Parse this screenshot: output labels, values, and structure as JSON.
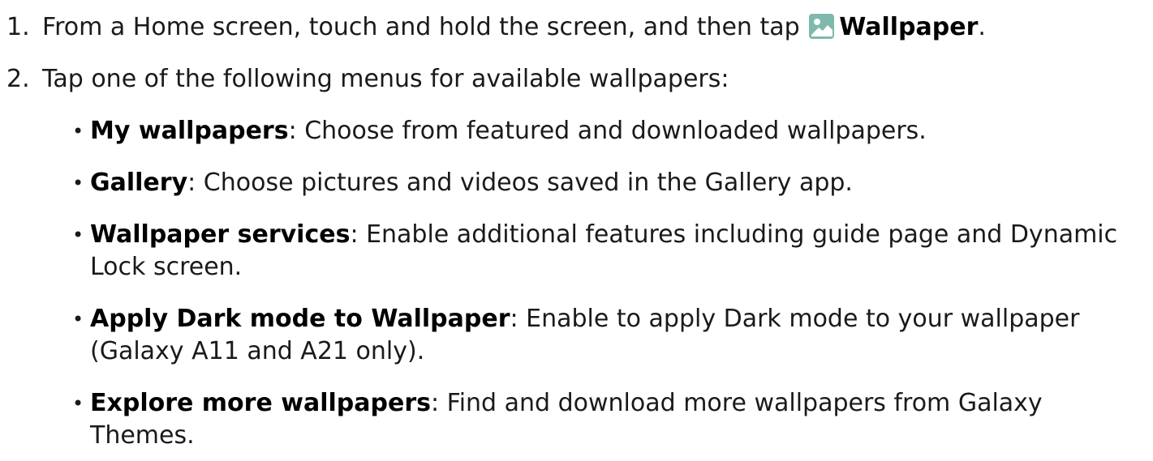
{
  "steps": [
    {
      "number": "1.",
      "text_before": "From a Home screen, touch and hold the screen, and then tap",
      "icon": "wallpaper-icon",
      "bold": "Wallpaper",
      "text_after": "."
    },
    {
      "number": "2.",
      "text": "Tap one of the following menus for available wallpapers:"
    }
  ],
  "bullets": [
    {
      "term": "My wallpapers",
      "desc": ": Choose from featured and downloaded wallpapers."
    },
    {
      "term": "Gallery",
      "desc": ": Choose pictures and videos saved in the Gallery app."
    },
    {
      "term": "Wallpaper services",
      "desc": ": Enable additional features including guide page and Dynamic Lock screen."
    },
    {
      "term": "Apply Dark mode to Wallpaper",
      "desc": ": Enable to apply Dark mode to your wallpaper (Galaxy A11 and A21 only)."
    },
    {
      "term": "Explore more wallpapers",
      "desc": ": Find and download more wallpapers from Galaxy Themes."
    }
  ],
  "bullet_glyph": "•",
  "colors": {
    "icon_bg": "#7fb9ad",
    "icon_fg": "#ffffff",
    "text": "#1a1a1a"
  }
}
